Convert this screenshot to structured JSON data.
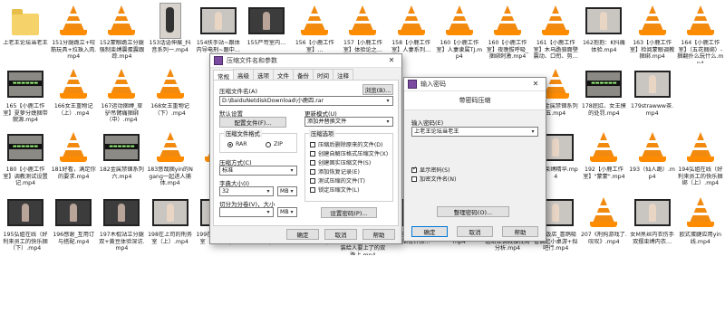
{
  "files": [
    {
      "name": "上老王论坛当老王",
      "kind": "folder",
      "row": 0,
      "col": 0
    },
    {
      "name": "151分腿跪立+咬筋玩具+拉珠入肉.mp4",
      "kind": "vlc",
      "row": 0,
      "col": 1
    },
    {
      "name": "152蒙眼跪立分腿强制束缚震蛋震跟踪.mp4",
      "kind": "vlc",
      "row": 0,
      "col": 2
    },
    {
      "name": "153话语伸展_抖音系列一.mp4",
      "kind": "tall",
      "row": 0,
      "col": 3
    },
    {
      "name": "154扶手站~跟体内导电刑~跟中…",
      "kind": "vid-light",
      "row": 0,
      "col": 4
    },
    {
      "name": "155严苛室内…",
      "kind": "vid-dark",
      "row": 0,
      "col": 5
    },
    {
      "name": "156【小鹿工作室】…",
      "kind": "vlc",
      "row": 0,
      "col": 6
    },
    {
      "name": "157【小鹿工作室】体验论之…",
      "kind": "vlc",
      "row": 0,
      "col": 7
    },
    {
      "name": "158【小鹿工作室】人妻系列…",
      "kind": "vlc",
      "row": 0,
      "col": 8
    },
    {
      "name": "160【小鹿工作室】人妻隶属TJ.mp4",
      "kind": "vlc",
      "row": 0,
      "col": 9
    },
    {
      "name": "160【小鹿工作室】夜晚拔呼吸_捆绑刺激.mp4",
      "kind": "vlc",
      "row": 0,
      "col": 10
    },
    {
      "name": "161【小鹿工作室】木马跪骑面壁震动、口衔、剪…",
      "kind": "vlc",
      "row": 0,
      "col": 11
    },
    {
      "name": "162抱抱：K抖痛体验.mp4",
      "kind": "vid-light",
      "row": 0,
      "col": 12
    },
    {
      "name": "163【小鹿工作室】检阅蒙眼调教捆绑.mp4",
      "kind": "vlc",
      "row": 0,
      "col": 13
    },
    {
      "name": "164【小鹿工作室】（五花捆绑）-捆翻扑么玩什么.mp4",
      "kind": "vlc",
      "row": 0,
      "col": 14
    },
    {
      "name": "165【小鹿工作室】夏萝分娩捆带貌源.mp4",
      "kind": "vid-film",
      "row": 1,
      "col": 0
    },
    {
      "name": "166女王重物记（上）.mp4",
      "kind": "vlc",
      "row": 1,
      "col": 1
    },
    {
      "name": "167运动捆缚_草驴吊臂痛捆绑（中）.mp4",
      "kind": "vlc",
      "row": 1,
      "col": 2
    },
    {
      "name": "168女王重物记（下）.mp4",
      "kind": "vlc",
      "row": 1,
      "col": 3
    },
    {
      "name": "177金属禁锢系列五.mp4",
      "kind": "vlc",
      "row": 1,
      "col": 11
    },
    {
      "name": "178屁肛、女王摸的处罚.mp4",
      "kind": "vid-film",
      "row": 1,
      "col": 12
    },
    {
      "name": "179strawww茶.mp4",
      "kind": "vid-light",
      "row": 1,
      "col": 13
    },
    {
      "name": "180【小鹿工作室】调教测试设置记.mp4",
      "kind": "vid-film",
      "row": 2,
      "col": 0
    },
    {
      "name": "181好看，满足你的要求.mp4",
      "kind": "vlc",
      "row": 2,
      "col": 1
    },
    {
      "name": "182金属禁锢系列六.mp4",
      "kind": "vid-film",
      "row": 2,
      "col": 2
    },
    {
      "name": "183悠哉捆yin的Ngang一起进人捕体.mp4",
      "kind": "vlc",
      "row": 2,
      "col": 3
    },
    {
      "name": "18…",
      "kind": "vlc",
      "row": 2,
      "col": 4
    },
    {
      "name": "…大束缚精华.mp4",
      "kind": "vid-light",
      "row": 2,
      "col": 11
    },
    {
      "name": "192【小鹿工作室】\"蒙蒙\".mp4",
      "kind": "vlc",
      "row": 2,
      "col": 12
    },
    {
      "name": "193（仙人跪）.mp4",
      "kind": "vlc",
      "row": 2,
      "col": 13
    },
    {
      "name": "194弘姐在线（好利来员工的快乐捆绑（上）.mp4",
      "kind": "vlc",
      "row": 2,
      "col": 14
    },
    {
      "name": "195弘姐在线（好利来员工的快乐捆（下）.mp4",
      "kind": "vid-dark",
      "row": 3,
      "col": 0
    },
    {
      "name": "196感谢_互用订与搭配.mp4",
      "kind": "vid-dark",
      "row": 3,
      "col": 1
    },
    {
      "name": "197木棍站立分腿双+黄豆体验深访.mp4",
      "kind": "vid-dark",
      "row": 3,
      "col": 2
    },
    {
      "name": "198在上司的刑务室（上）.mp4",
      "kind": "vid-light",
      "row": 3,
      "col": 3
    },
    {
      "name": "199在上司的刑务室（下）.mp4",
      "kind": "vid-light",
      "row": 3,
      "col": 4
    },
    {
      "name": "200捆绑调进最懂难.mp4",
      "kind": "vid-dark",
      "row": 3,
      "col": 5
    },
    {
      "name": "201驼伯_调教站磨的罢罚.mp4",
      "kind": "vid-dark",
      "row": 3,
      "col": 6
    },
    {
      "name": "202两个最新设置了内裤高的调教服装给人要上了的双跪上.mp4",
      "kind": "vid-light",
      "row": 3,
      "col": 7
    },
    {
      "name": "203这个最简约知道+捆设计撩…",
      "kind": "vid-dark",
      "row": 3,
      "col": 8
    },
    {
      "name": "204《录影日记》.mp4",
      "kind": "vid-light",
      "row": 3,
      "col": 9
    },
    {
      "name": "205细棍缠身_精选站立调教接视角分析.mp4",
      "kind": "vid-dark",
      "row": 3,
      "col": 10
    },
    {
      "name": "206饭店_喜鹊吸管调起小桌游+拟吧行.mp4",
      "kind": "vid-light",
      "row": 3,
      "col": 11
    },
    {
      "name": "207《刑拘游戏了.叹叹》.mp4",
      "kind": "vlc",
      "row": 3,
      "col": 12
    },
    {
      "name": "女M黑丝内衣伤手双摆束缚内衣…",
      "kind": "vid-light",
      "row": 3,
      "col": 13
    },
    {
      "name": "欧式蛋腱应用yin线.mp4",
      "kind": "vlc",
      "row": 3,
      "col": 14
    }
  ],
  "archive_dialog": {
    "title": "压缩文件名和参数",
    "tabs": [
      "常规",
      "高级",
      "选项",
      "文件",
      "备份",
      "时间",
      "注释"
    ],
    "archive_name_label": "压缩文件名(A)",
    "browse_button": "浏览(B)...",
    "archive_name_value": "D:\\BaiduNetdiskDownload\\小鹿四.rar",
    "profile_label": "默认设置",
    "profile_button": "配置文件(F)...",
    "update_mode_label": "更新模式(U)",
    "update_mode_value": "添加并替换文件",
    "format_group": "压缩文件格式",
    "format_rar": "RAR",
    "format_zip": "ZIP",
    "options_group": "压缩选项",
    "options": [
      {
        "label": "压缩后删除原来的文件(D)",
        "checked": false
      },
      {
        "label": "创建自解压格式压缩文件(X)",
        "checked": false
      },
      {
        "label": "创建固实压缩文件(S)",
        "checked": false
      },
      {
        "label": "添加恢复记录(E)",
        "checked": false
      },
      {
        "label": "测试压缩的文件(T)",
        "checked": false
      },
      {
        "label": "锁定压缩文件(L)",
        "checked": false
      }
    ],
    "method_label": "压缩方式(C)",
    "method_value": "标准",
    "dict_label": "字典大小(I)",
    "dict_value": "32",
    "dict_unit": "MB",
    "split_label": "切分为分卷(V)，大小",
    "split_unit": "MB",
    "set_password_button": "设置密码(P)...",
    "ok_button": "确定",
    "cancel_button": "取消",
    "help_button": "帮助"
  },
  "password_dialog": {
    "title": "输入密码",
    "heading": "带密码压缩",
    "password_label": "输入密码(E)",
    "password_value": "上老王论坛当老王",
    "show_password": {
      "label": "显示密码(S)",
      "checked": true
    },
    "encrypt_names": {
      "label": "加密文件名(N)",
      "checked": false
    },
    "organize_button": "整理密码(O)...",
    "ok_button": "确定",
    "cancel_button": "取消",
    "help_button": "帮助"
  }
}
